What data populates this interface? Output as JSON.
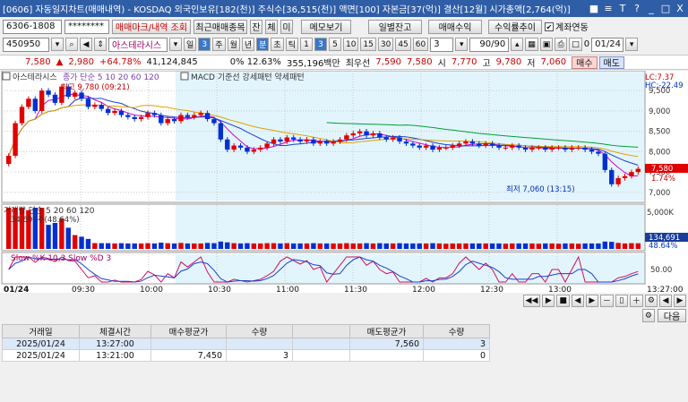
{
  "window": {
    "title": "[0606] 자동일지차트(매매내역) - KOSDAQ 외국인보유[182(천)] 주식수[36,515(천)] 액면[100] 자본금[37(억)] 결산[12월] 시가총액[2,764(억)]",
    "controls": [
      "■",
      "≡",
      "T",
      "?",
      "_",
      "□",
      "X"
    ]
  },
  "row1": {
    "account": "6306-1808",
    "password": "********",
    "trade_mark_btn": "매매마크/내역 조회",
    "recent_btn": "최근매매종목",
    "small_btns": [
      "잔",
      "체",
      "미"
    ],
    "memo_btn": "메모보기",
    "daily_balance_btn": "일별잔고",
    "trade_profit_btn": "매매수익",
    "profit_trend_btn": "수익률추이",
    "account_link_label": "계좌연동"
  },
  "row2": {
    "code": "450950",
    "name": "아스테라시스",
    "period_btns": [
      "일",
      "3",
      "주",
      "월",
      "년",
      "분",
      "초",
      "틱"
    ],
    "interval_btns": [
      "1",
      "3",
      "5",
      "10",
      "15",
      "30",
      "45",
      "60"
    ],
    "count": "3",
    "range": "90/90",
    "date": "01/24",
    "zero": "0"
  },
  "quote": {
    "price": "7,580",
    "change": "2,980",
    "change_pct": "+64.78%",
    "volume": "41,124,845",
    "turnover": "0% 12.63%",
    "amount": "355,196백만",
    "prev_label": "최우선",
    "ask": "7,590",
    "bid": "7,580",
    "open_label": "시",
    "open": "7,770",
    "high_label": "고",
    "high": "9,780",
    "low_label": "저",
    "low": "7,060",
    "buy_btn": "매수",
    "sell_btn": "매도"
  },
  "chart_labels": {
    "main_legend": "아스테라시스",
    "ma_legend": "종가 단순 5 10 20 60 120",
    "macd_legend": "MACD 기준선 강세패턴 약세패턴",
    "high_note": "최고 9,780 (09:21)",
    "low_note": "최저 7,060 (13:15)",
    "lc": "LC:7.37",
    "hc": "HC:-22.49",
    "cur_price": "7,580",
    "cur_pct": "1.74%",
    "vol_legend": "거래량 단순 5 20 60 120",
    "vol_value": "34,691주(48.64%)",
    "vol_cur": "134,691",
    "vol_pct": "48.64%",
    "vol_axis_top": "5,000K",
    "stoch_legend": "Slow %K 10,3  Slow %D 3",
    "stoch_axis": "50.00",
    "date_label": "01/24",
    "end_time": "13:27:00"
  },
  "chart_data": {
    "type": "candlestick",
    "ylim": [
      6800,
      9900
    ],
    "y_ticks": [
      "9,500",
      "9,000",
      "8,500",
      "8,000",
      "7,500",
      "7,000"
    ],
    "y_values": [
      9500,
      9000,
      8500,
      8000,
      7500,
      7000
    ],
    "x_ticks": [
      "09:30",
      "10:00",
      "10:30",
      "11:00",
      "11:30",
      "12:00",
      "12:30",
      "13:00"
    ],
    "closes": [
      7900,
      8700,
      9100,
      9300,
      9000,
      9500,
      9400,
      9200,
      9600,
      9350,
      9450,
      9300,
      9100,
      9150,
      9050,
      8950,
      9000,
      8900,
      8850,
      8800,
      8850,
      8950,
      8900,
      8700,
      8800,
      8750,
      8900,
      8850,
      8900,
      8950,
      8800,
      8700,
      8300,
      8050,
      8150,
      8100,
      8000,
      8050,
      8100,
      8200,
      8300,
      8250,
      8350,
      8300,
      8250,
      8300,
      8200,
      8250,
      8200,
      8250,
      8300,
      8400,
      8450,
      8500,
      8400,
      8450,
      8350,
      8300,
      8350,
      8250,
      8200,
      8150,
      8100,
      8150,
      8050,
      8100,
      8100,
      8150,
      8200,
      8250,
      8200,
      8150,
      8200,
      8150,
      8100,
      8100,
      8150,
      8100,
      8050,
      8100,
      8100,
      8050,
      8100,
      8100,
      8050,
      8100,
      8100,
      8050,
      8000,
      7950,
      7550,
      7200,
      7350,
      7400,
      7500,
      7580
    ]
  },
  "table": {
    "headers": [
      "거래일",
      "체결시간",
      "매수평균가",
      "수량",
      "",
      "매도평균가",
      "수량"
    ],
    "rows": [
      [
        "2025/01/24",
        "13:27:00",
        "",
        "",
        "",
        "7,560",
        "3"
      ],
      [
        "2025/01/24",
        "13:21:00",
        "7,450",
        "3",
        "",
        "",
        "0"
      ]
    ]
  },
  "bottom": {
    "next_btn": "다음"
  }
}
